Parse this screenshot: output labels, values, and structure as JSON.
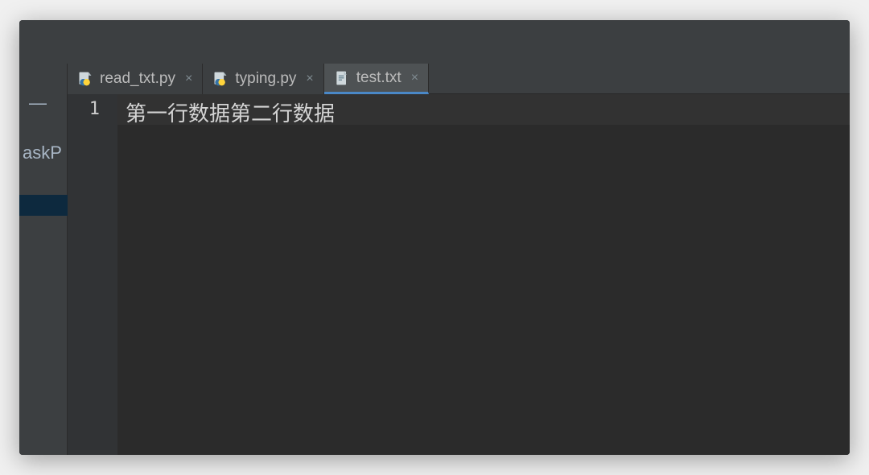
{
  "sidebar": {
    "minimize_glyph": "—",
    "clipped_label": "askP"
  },
  "tabs": [
    {
      "label": "read_txt.py",
      "type": "python",
      "active": false
    },
    {
      "label": "typing.py",
      "type": "python",
      "active": false
    },
    {
      "label": "test.txt",
      "type": "text",
      "active": true
    }
  ],
  "editor": {
    "line_numbers": [
      "1"
    ],
    "lines": [
      "第一行数据第二行数据"
    ]
  },
  "icons": {
    "close": "×"
  },
  "colors": {
    "tab_underline": "#4a88c7",
    "gutter_bg": "#313335",
    "editor_bg": "#2b2b2b",
    "chrome_bg": "#3c3f41"
  }
}
